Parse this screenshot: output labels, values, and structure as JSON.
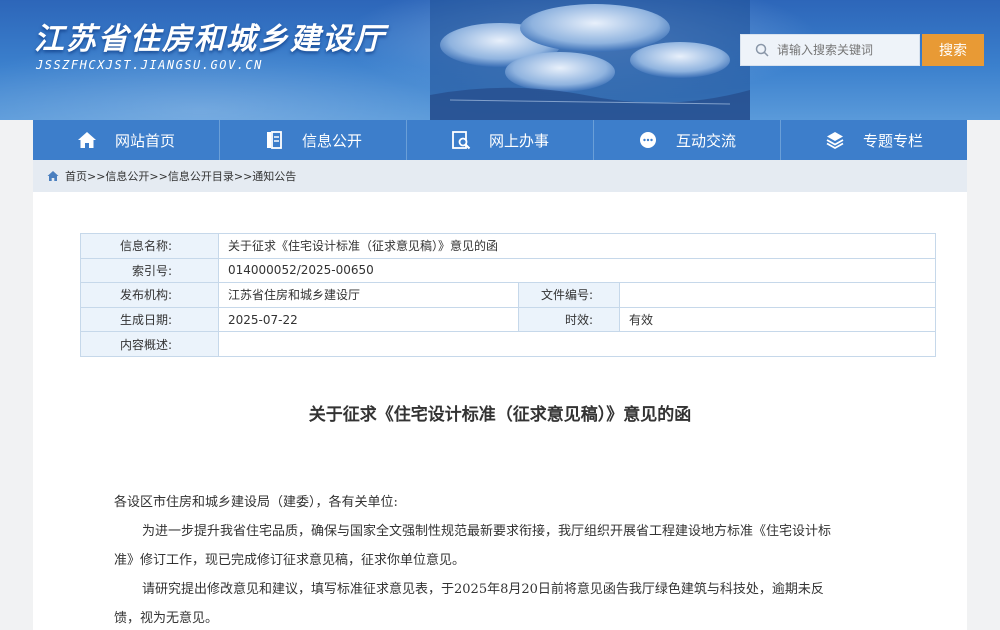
{
  "header": {
    "title": "江苏省住房和城乡建设厅",
    "url": "JSSZFHCXJST.JIANGSU.GOV.CN",
    "search_placeholder": "请输入搜索关键词",
    "search_button": "搜索"
  },
  "nav": [
    {
      "label": "网站首页",
      "icon": "home-icon"
    },
    {
      "label": "信息公开",
      "icon": "document-icon"
    },
    {
      "label": "网上办事",
      "icon": "search-doc-icon"
    },
    {
      "label": "互动交流",
      "icon": "chat-icon"
    },
    {
      "label": "专题专栏",
      "icon": "layers-icon"
    }
  ],
  "breadcrumb": "首页>>信息公开>>信息公开目录>>通知公告",
  "info": {
    "name_label": "信息名称:",
    "name_value": "关于征求《住宅设计标准（征求意见稿）》意见的函",
    "index_label": "索引号:",
    "index_value": "014000052/2025-00650",
    "org_label": "发布机构:",
    "org_value": "江苏省住房和城乡建设厅",
    "docno_label": "文件编号:",
    "docno_value": "",
    "date_label": "生成日期:",
    "date_value": "2025-07-22",
    "validity_label": "时效:",
    "validity_value": "有效",
    "summary_label": "内容概述:",
    "summary_value": ""
  },
  "document": {
    "title": "关于征求《住宅设计标准（征求意见稿）》意见的函",
    "salutation": "各设区市住房和城乡建设局（建委），各有关单位:",
    "para1_line1": "为进一步提升我省住宅品质，确保与国家全文强制性规范最新要求衔接，我厅组织开展省工程建设地方标准《住宅设计标",
    "para1_line2": "准》修订工作，现已完成修订征求意见稿，征求你单位意见。",
    "para2_line1": "请研究提出修改意见和建议，填写标准征求意见表，于2025年8月20日前将意见函告我厅绿色建筑与科技处，逾期未反",
    "para2_line2": "馈，视为无意见。"
  },
  "colors": {
    "nav": "#3d7ecb",
    "search_button": "#e89a35",
    "label_bg": "#ebf3fb"
  }
}
